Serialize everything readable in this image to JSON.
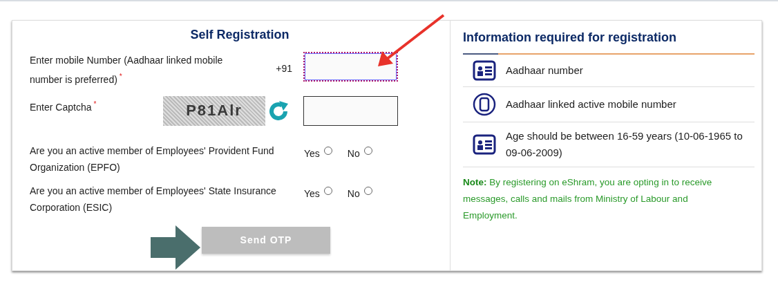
{
  "form": {
    "title": "Self Registration",
    "mobile": {
      "label": "Enter mobile Number (Aadhaar linked mobile number is preferred)",
      "required_mark": "*",
      "prefix": "+91",
      "focused": true
    },
    "captcha": {
      "label": "Enter Captcha",
      "required_mark": "*",
      "code": "P81Alr"
    },
    "questions": [
      {
        "text": "Are you an active member of Employees' Provident Fund Organization (EPFO)",
        "options": [
          {
            "label": "Yes",
            "selected": false
          },
          {
            "label": "No",
            "selected": false
          }
        ]
      },
      {
        "text": "Are you an active member of Employees' State Insurance Corporation (ESIC)",
        "options": [
          {
            "label": "Yes",
            "selected": false
          },
          {
            "label": "No",
            "selected": false
          }
        ]
      }
    ],
    "submit": {
      "label": "Send OTP",
      "disabled": true
    }
  },
  "info": {
    "title": "Information required for registration",
    "items": [
      {
        "kind": "card",
        "text": "Aadhaar number"
      },
      {
        "kind": "phone",
        "text": "Aadhaar linked active mobile number"
      },
      {
        "kind": "card",
        "text": "Age should be between 16-59 years (10-06-1965 to 09-06-2009)"
      }
    ],
    "note": "**Note:** By registering on eShram, you are opting in to receive messages, calls and mails from Ministry of Labour and Employment."
  }
}
